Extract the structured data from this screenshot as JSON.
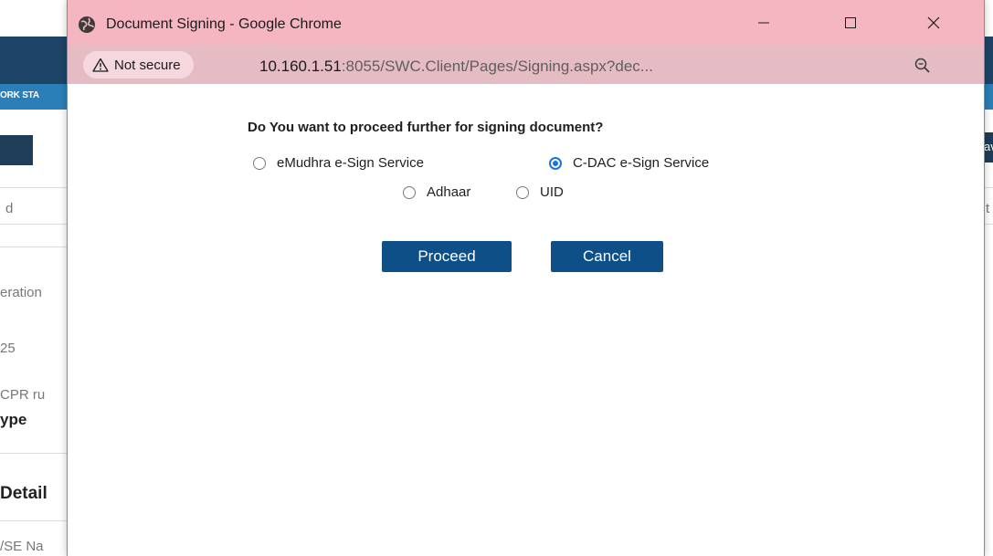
{
  "background_page": {
    "nav_text": "ORK STA",
    "left_labels": [
      "d",
      "eration",
      "25",
      "CPR ru",
      "ype",
      "Detail",
      "/SE Na"
    ],
    "right_fragments": [
      "av",
      "t"
    ]
  },
  "window": {
    "title": "Document Signing - Google Chrome",
    "controls": {
      "minimize": "minimize",
      "maximize": "maximize",
      "close": "close"
    }
  },
  "address_bar": {
    "security_label": "Not secure",
    "url_host": "10.160.1.51",
    "url_rest": ":8055/SWC.Client/Pages/Signing.aspx?dec..."
  },
  "dialog": {
    "question": "Do You want to proceed further for signing document?",
    "service_options": [
      {
        "label": "eMudhra e-Sign Service",
        "checked": false
      },
      {
        "label": "C-DAC e-Sign Service",
        "checked": true
      }
    ],
    "id_options": [
      {
        "label": "Adhaar",
        "checked": false
      },
      {
        "label": "UID",
        "checked": false
      }
    ],
    "proceed_label": "Proceed",
    "cancel_label": "Cancel"
  },
  "colors": {
    "titlebar": "#f5b6c1",
    "addressbar": "#e6bcc4",
    "button": "#0e4f88",
    "radio_accent": "#1a73e8"
  }
}
